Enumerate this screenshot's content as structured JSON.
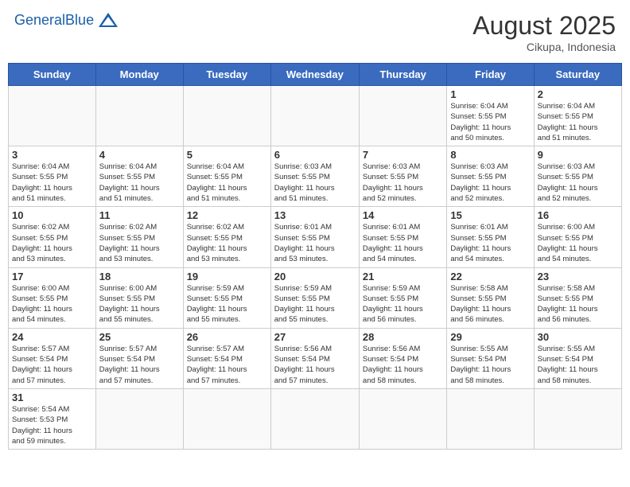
{
  "header": {
    "logo_general": "General",
    "logo_blue": "Blue",
    "month_year": "August 2025",
    "location": "Cikupa, Indonesia"
  },
  "days_of_week": [
    "Sunday",
    "Monday",
    "Tuesday",
    "Wednesday",
    "Thursday",
    "Friday",
    "Saturday"
  ],
  "weeks": [
    [
      {
        "day": "",
        "info": ""
      },
      {
        "day": "",
        "info": ""
      },
      {
        "day": "",
        "info": ""
      },
      {
        "day": "",
        "info": ""
      },
      {
        "day": "",
        "info": ""
      },
      {
        "day": "1",
        "info": "Sunrise: 6:04 AM\nSunset: 5:55 PM\nDaylight: 11 hours\nand 50 minutes."
      },
      {
        "day": "2",
        "info": "Sunrise: 6:04 AM\nSunset: 5:55 PM\nDaylight: 11 hours\nand 51 minutes."
      }
    ],
    [
      {
        "day": "3",
        "info": "Sunrise: 6:04 AM\nSunset: 5:55 PM\nDaylight: 11 hours\nand 51 minutes."
      },
      {
        "day": "4",
        "info": "Sunrise: 6:04 AM\nSunset: 5:55 PM\nDaylight: 11 hours\nand 51 minutes."
      },
      {
        "day": "5",
        "info": "Sunrise: 6:04 AM\nSunset: 5:55 PM\nDaylight: 11 hours\nand 51 minutes."
      },
      {
        "day": "6",
        "info": "Sunrise: 6:03 AM\nSunset: 5:55 PM\nDaylight: 11 hours\nand 51 minutes."
      },
      {
        "day": "7",
        "info": "Sunrise: 6:03 AM\nSunset: 5:55 PM\nDaylight: 11 hours\nand 52 minutes."
      },
      {
        "day": "8",
        "info": "Sunrise: 6:03 AM\nSunset: 5:55 PM\nDaylight: 11 hours\nand 52 minutes."
      },
      {
        "day": "9",
        "info": "Sunrise: 6:03 AM\nSunset: 5:55 PM\nDaylight: 11 hours\nand 52 minutes."
      }
    ],
    [
      {
        "day": "10",
        "info": "Sunrise: 6:02 AM\nSunset: 5:55 PM\nDaylight: 11 hours\nand 53 minutes."
      },
      {
        "day": "11",
        "info": "Sunrise: 6:02 AM\nSunset: 5:55 PM\nDaylight: 11 hours\nand 53 minutes."
      },
      {
        "day": "12",
        "info": "Sunrise: 6:02 AM\nSunset: 5:55 PM\nDaylight: 11 hours\nand 53 minutes."
      },
      {
        "day": "13",
        "info": "Sunrise: 6:01 AM\nSunset: 5:55 PM\nDaylight: 11 hours\nand 53 minutes."
      },
      {
        "day": "14",
        "info": "Sunrise: 6:01 AM\nSunset: 5:55 PM\nDaylight: 11 hours\nand 54 minutes."
      },
      {
        "day": "15",
        "info": "Sunrise: 6:01 AM\nSunset: 5:55 PM\nDaylight: 11 hours\nand 54 minutes."
      },
      {
        "day": "16",
        "info": "Sunrise: 6:00 AM\nSunset: 5:55 PM\nDaylight: 11 hours\nand 54 minutes."
      }
    ],
    [
      {
        "day": "17",
        "info": "Sunrise: 6:00 AM\nSunset: 5:55 PM\nDaylight: 11 hours\nand 54 minutes."
      },
      {
        "day": "18",
        "info": "Sunrise: 6:00 AM\nSunset: 5:55 PM\nDaylight: 11 hours\nand 55 minutes."
      },
      {
        "day": "19",
        "info": "Sunrise: 5:59 AM\nSunset: 5:55 PM\nDaylight: 11 hours\nand 55 minutes."
      },
      {
        "day": "20",
        "info": "Sunrise: 5:59 AM\nSunset: 5:55 PM\nDaylight: 11 hours\nand 55 minutes."
      },
      {
        "day": "21",
        "info": "Sunrise: 5:59 AM\nSunset: 5:55 PM\nDaylight: 11 hours\nand 56 minutes."
      },
      {
        "day": "22",
        "info": "Sunrise: 5:58 AM\nSunset: 5:55 PM\nDaylight: 11 hours\nand 56 minutes."
      },
      {
        "day": "23",
        "info": "Sunrise: 5:58 AM\nSunset: 5:55 PM\nDaylight: 11 hours\nand 56 minutes."
      }
    ],
    [
      {
        "day": "24",
        "info": "Sunrise: 5:57 AM\nSunset: 5:54 PM\nDaylight: 11 hours\nand 57 minutes."
      },
      {
        "day": "25",
        "info": "Sunrise: 5:57 AM\nSunset: 5:54 PM\nDaylight: 11 hours\nand 57 minutes."
      },
      {
        "day": "26",
        "info": "Sunrise: 5:57 AM\nSunset: 5:54 PM\nDaylight: 11 hours\nand 57 minutes."
      },
      {
        "day": "27",
        "info": "Sunrise: 5:56 AM\nSunset: 5:54 PM\nDaylight: 11 hours\nand 57 minutes."
      },
      {
        "day": "28",
        "info": "Sunrise: 5:56 AM\nSunset: 5:54 PM\nDaylight: 11 hours\nand 58 minutes."
      },
      {
        "day": "29",
        "info": "Sunrise: 5:55 AM\nSunset: 5:54 PM\nDaylight: 11 hours\nand 58 minutes."
      },
      {
        "day": "30",
        "info": "Sunrise: 5:55 AM\nSunset: 5:54 PM\nDaylight: 11 hours\nand 58 minutes."
      }
    ],
    [
      {
        "day": "31",
        "info": "Sunrise: 5:54 AM\nSunset: 5:53 PM\nDaylight: 11 hours\nand 59 minutes."
      },
      {
        "day": "",
        "info": ""
      },
      {
        "day": "",
        "info": ""
      },
      {
        "day": "",
        "info": ""
      },
      {
        "day": "",
        "info": ""
      },
      {
        "day": "",
        "info": ""
      },
      {
        "day": "",
        "info": ""
      }
    ]
  ]
}
